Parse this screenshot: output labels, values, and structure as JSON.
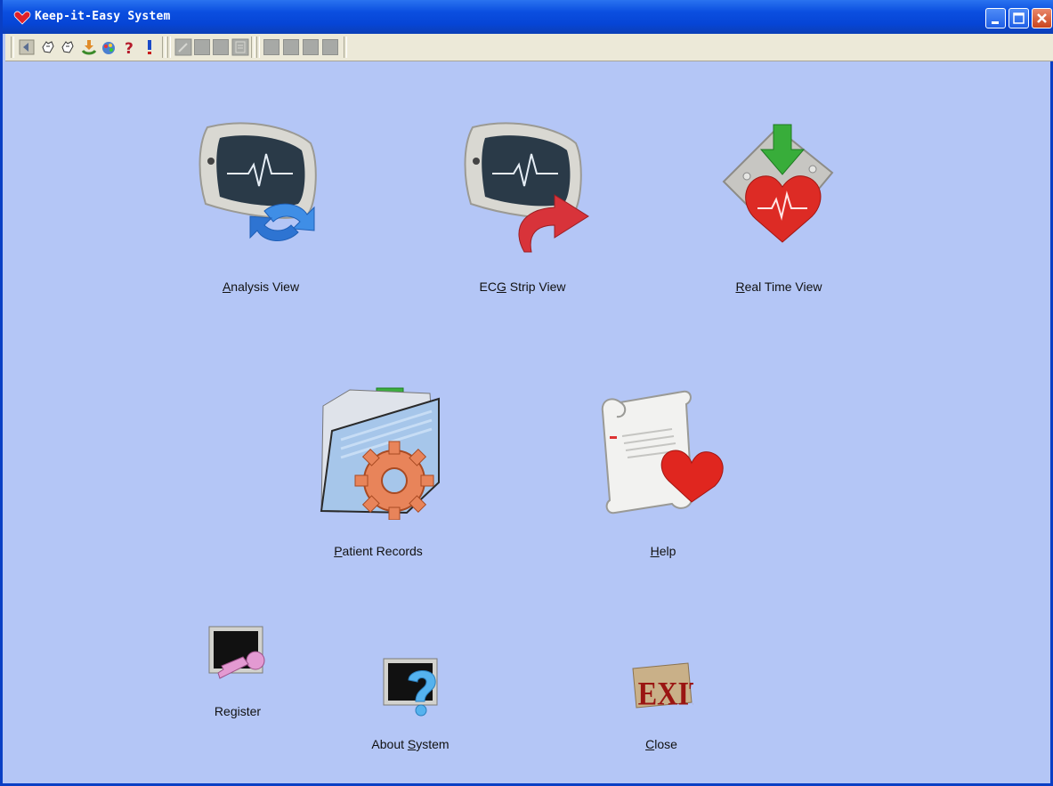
{
  "window": {
    "title": "Keep-it-Easy System",
    "controls": [
      "minimize",
      "maximize",
      "close"
    ]
  },
  "toolbar": {
    "icons": [
      "back-icon",
      "hand-pointer-icon",
      "hand-pointer-2-icon",
      "download-icon",
      "palette-icon",
      "help-question-icon",
      "info-exclamation-icon",
      "edit-disabled-icon",
      "blank-disabled-icon",
      "blank-disabled-icon",
      "document-disabled-icon",
      "blank-disabled-icon",
      "blank-disabled-icon",
      "blank-disabled-icon",
      "blank-disabled-icon"
    ]
  },
  "launcher": {
    "analysis_view": {
      "pre": "",
      "key": "A",
      "post": "nalysis View"
    },
    "ecg_strip_view": {
      "pre": "EC",
      "key": "G",
      "post": " Strip View"
    },
    "real_time_view": {
      "pre": "",
      "key": "R",
      "post": "eal Time View"
    },
    "patient_records": {
      "pre": "",
      "key": "P",
      "post": "atient Records"
    },
    "help": {
      "pre": "",
      "key": "H",
      "post": "elp"
    },
    "register": {
      "label": "Register"
    },
    "about_system": {
      "pre": "About ",
      "key": "S",
      "post": "ystem"
    },
    "close": {
      "pre": "",
      "key": "C",
      "post": "lose"
    },
    "exit_sign_text": "EXIT"
  },
  "colors": {
    "background": "#b4c6f6",
    "titlebar": "#0b4fe0",
    "toolbar": "#ece9d8"
  }
}
